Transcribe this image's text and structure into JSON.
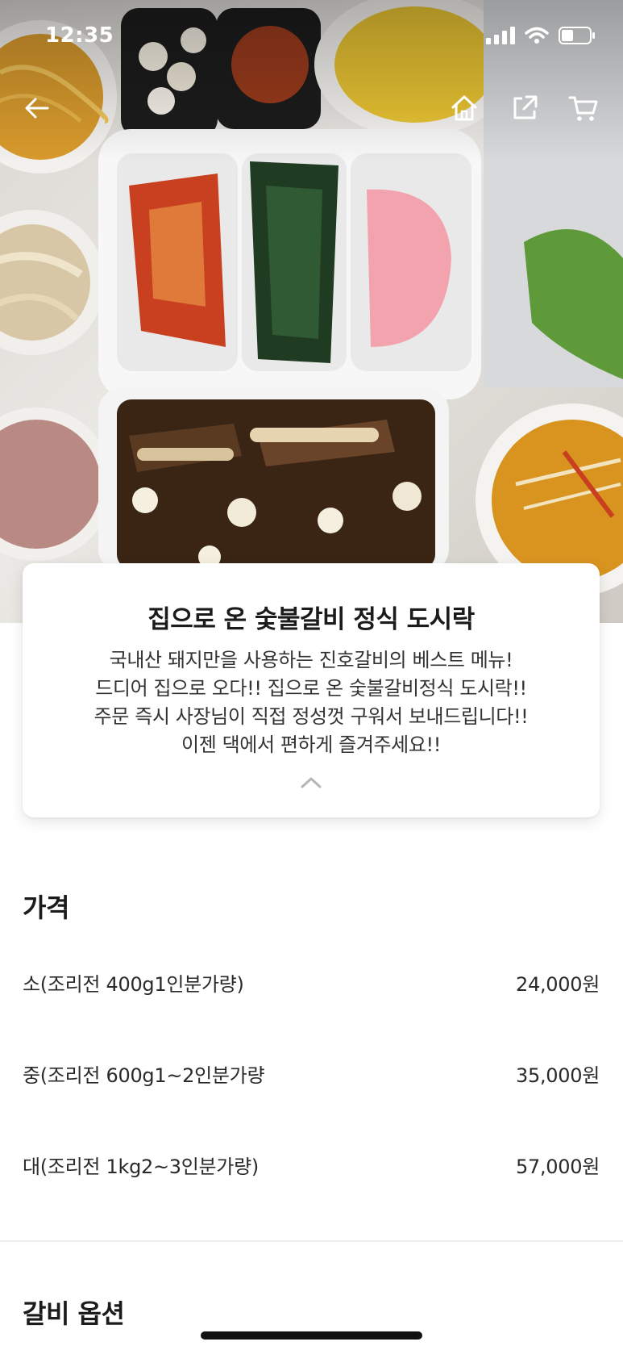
{
  "status_bar": {
    "time": "12:35"
  },
  "nav": {
    "back_icon": "arrow-left-icon",
    "home_icon": "home-icon",
    "share_icon": "share-icon",
    "cart_icon": "cart-icon"
  },
  "hero": {
    "image_desc": "korean-galbi-lunchbox-with-side-dishes"
  },
  "menu_card": {
    "title": "집으로 온 숯불갈비 정식 도시락",
    "description_lines": [
      "국내산 돼지만을 사용하는 진호갈비의 베스트 메뉴!",
      "드디어 집으로 오다!! 집으로 온 숯불갈비정식 도시락!!",
      "주문 즉시 사장님이 직접 정성껏 구워서 보내드립니다!!",
      "이젠 댁에서 편하게 즐겨주세요!!"
    ],
    "collapse_icon": "chevron-up-icon"
  },
  "price_section": {
    "title": "가격",
    "rows": [
      {
        "label": "소(조리전 400g1인분가량)",
        "price": "24,000원"
      },
      {
        "label": "중(조리전 600g1~2인분가량",
        "price": "35,000원"
      },
      {
        "label": "대(조리전 1kg2~3인분가량)",
        "price": "57,000원"
      }
    ]
  },
  "option_section": {
    "title": "갈비 옵션"
  },
  "colors": {
    "text_primary": "#1b1b1b",
    "text_secondary": "#333333",
    "divider": "#eeeeee",
    "card_bg": "#ffffff"
  }
}
